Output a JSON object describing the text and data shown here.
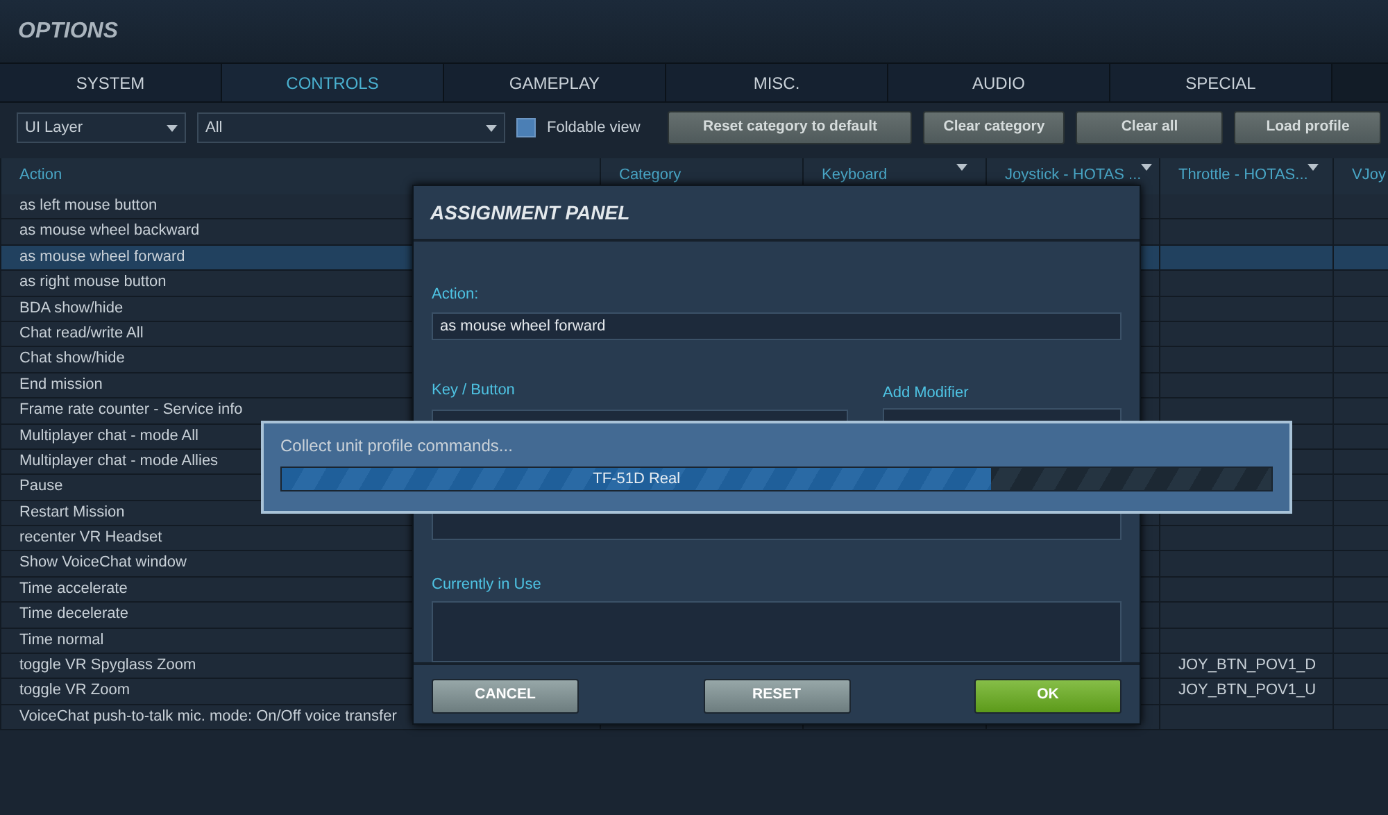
{
  "window": {
    "title": "OPTIONS"
  },
  "tabs": [
    {
      "label": "SYSTEM",
      "selected": false
    },
    {
      "label": "CONTROLS",
      "selected": true
    },
    {
      "label": "GAMEPLAY",
      "selected": false
    },
    {
      "label": "MISC.",
      "selected": false
    },
    {
      "label": "AUDIO",
      "selected": false
    },
    {
      "label": "SPECIAL",
      "selected": false
    }
  ],
  "toolbar": {
    "layer_dropdown": "UI Layer",
    "category_dropdown": "All",
    "foldable_view": {
      "label": "Foldable view",
      "checked": false
    },
    "buttons": [
      "Reset category to default",
      "Clear category",
      "Clear all",
      "Load profile"
    ]
  },
  "table": {
    "columns": [
      {
        "label": "Action",
        "dropdown": false
      },
      {
        "label": "Category",
        "dropdown": false
      },
      {
        "label": "Keyboard",
        "dropdown": true
      },
      {
        "label": "Joystick - HOTAS ...",
        "dropdown": true
      },
      {
        "label": "Throttle - HOTAS...",
        "dropdown": true
      },
      {
        "label": "VJoy",
        "dropdown": false
      }
    ],
    "rows": [
      {
        "action": "as left mouse button",
        "selected": false
      },
      {
        "action": "as mouse wheel backward",
        "selected": false
      },
      {
        "action": "as mouse wheel forward",
        "selected": true
      },
      {
        "action": "as right mouse button",
        "selected": false
      },
      {
        "action": "BDA show/hide",
        "selected": false
      },
      {
        "action": "Chat read/write All",
        "selected": false
      },
      {
        "action": "Chat show/hide",
        "selected": false
      },
      {
        "action": "End mission",
        "selected": false
      },
      {
        "action": "Frame rate counter - Service info",
        "selected": false
      },
      {
        "action": "Multiplayer chat - mode All",
        "selected": false
      },
      {
        "action": "Multiplayer chat - mode Allies",
        "selected": false
      },
      {
        "action": "Pause",
        "selected": false
      },
      {
        "action": "Restart Mission",
        "selected": false
      },
      {
        "action": "recenter VR Headset",
        "selected": false
      },
      {
        "action": "Show VoiceChat window",
        "selected": false
      },
      {
        "action": "Time accelerate",
        "selected": false
      },
      {
        "action": "Time decelerate",
        "selected": false
      },
      {
        "action": "Time normal",
        "selected": false
      },
      {
        "action": "toggle VR Spyglass Zoom",
        "throttle": "JOY_BTN_POV1_D",
        "selected": false
      },
      {
        "action": "toggle VR Zoom",
        "throttle": "JOY_BTN_POV1_U",
        "selected": false
      },
      {
        "action": "VoiceChat push-to-talk mic. mode: On/Off voice transfer",
        "selected": false
      }
    ]
  },
  "assignment_panel": {
    "title": "ASSIGNMENT PANEL",
    "action_label": "Action:",
    "action_value": "as mouse wheel forward",
    "key_label": "Key / Button",
    "modifier_label": "Add Modifier",
    "in_use_label": "Currently in Use",
    "buttons": [
      {
        "label": "CANCEL",
        "kind": "grey"
      },
      {
        "label": "RESET",
        "kind": "grey"
      },
      {
        "label": "OK",
        "kind": "green"
      }
    ]
  },
  "progress_dialog": {
    "message": "Collect unit profile commands...",
    "bar_label": "TF-51D Real",
    "level": 0.717
  }
}
